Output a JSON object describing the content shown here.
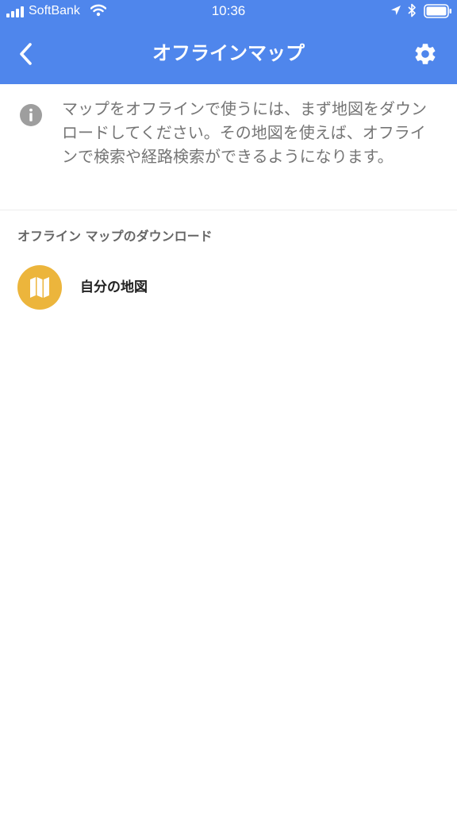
{
  "status_bar": {
    "carrier": "SoftBank",
    "time": "10:36",
    "icons": [
      "signal-bars-icon",
      "wifi-icon",
      "location-arrow-icon",
      "bluetooth-icon",
      "battery-icon"
    ]
  },
  "header": {
    "title": "オフラインマップ",
    "back_icon": "chevron-left-icon",
    "settings_icon": "gear-icon",
    "background_color": "#4f86ec"
  },
  "info": {
    "icon": "info-icon",
    "text": "マップをオフラインで使うには、まず地図をダウンロードしてください。その地図を使えば、オフラインで検索や経路検索ができるようになります。"
  },
  "section": {
    "header": "オフライン マップのダウンロード"
  },
  "items": [
    {
      "label": "自分の地図",
      "icon": "folded-map-icon",
      "icon_background": "#ecb53c"
    }
  ]
}
